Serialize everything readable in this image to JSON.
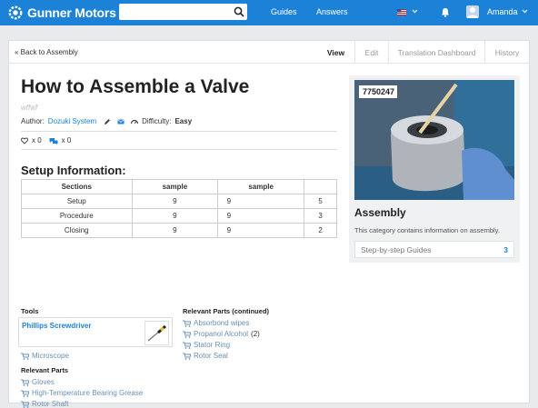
{
  "header": {
    "brand": "Gunner Motors",
    "search_placeholder": "",
    "nav": [
      "Guides",
      "Answers"
    ],
    "user": "Amanda"
  },
  "subnav": {
    "back": "« Back to Assembly",
    "tabs": [
      "View",
      "Edit",
      "Translation Dashboard",
      "History"
    ],
    "active_tab": "View"
  },
  "guide": {
    "title": "How to Assemble a Valve",
    "subtitle": "wffwf",
    "author_label": "Author:",
    "author": "Dozuki System",
    "difficulty_label": "Difficulty:",
    "difficulty": "Easy",
    "likes": "x 0",
    "comments": "x 0"
  },
  "setup": {
    "heading": "Setup Information:",
    "columns": [
      "Sections",
      "sample",
      "sample"
    ],
    "rows": [
      [
        "Setup",
        "9",
        "9",
        "5"
      ],
      [
        "Procedure",
        "9",
        "9",
        "3"
      ],
      [
        "Closing",
        "9",
        "9",
        "2"
      ]
    ]
  },
  "sidebar": {
    "image_label": "7750247",
    "title": "Assembly",
    "description": "This category contains information on assembly.",
    "guides_label": "Step-by-step Guides",
    "guides_count": "3"
  },
  "tools": {
    "heading": "Tools",
    "featured": "Phillips Screwdriver",
    "other": "Microscope"
  },
  "relevant_parts": {
    "heading": "Relevant Parts",
    "items": [
      "Gloves",
      "High-Temperature Bearing Grease",
      "Rotor Shaft"
    ]
  },
  "relevant_parts_continued": {
    "heading": "Relevant Parts (continued)",
    "items": [
      {
        "name": "Absorbond wipes",
        "qty": ""
      },
      {
        "name": "Propanol Alcohol",
        "qty": "(2)"
      },
      {
        "name": "Stator Ring",
        "qty": ""
      },
      {
        "name": "Rotor Seal",
        "qty": ""
      }
    ]
  },
  "colors": {
    "brand_blue": "#1c82d8",
    "part_link": "#6b8fb5"
  }
}
